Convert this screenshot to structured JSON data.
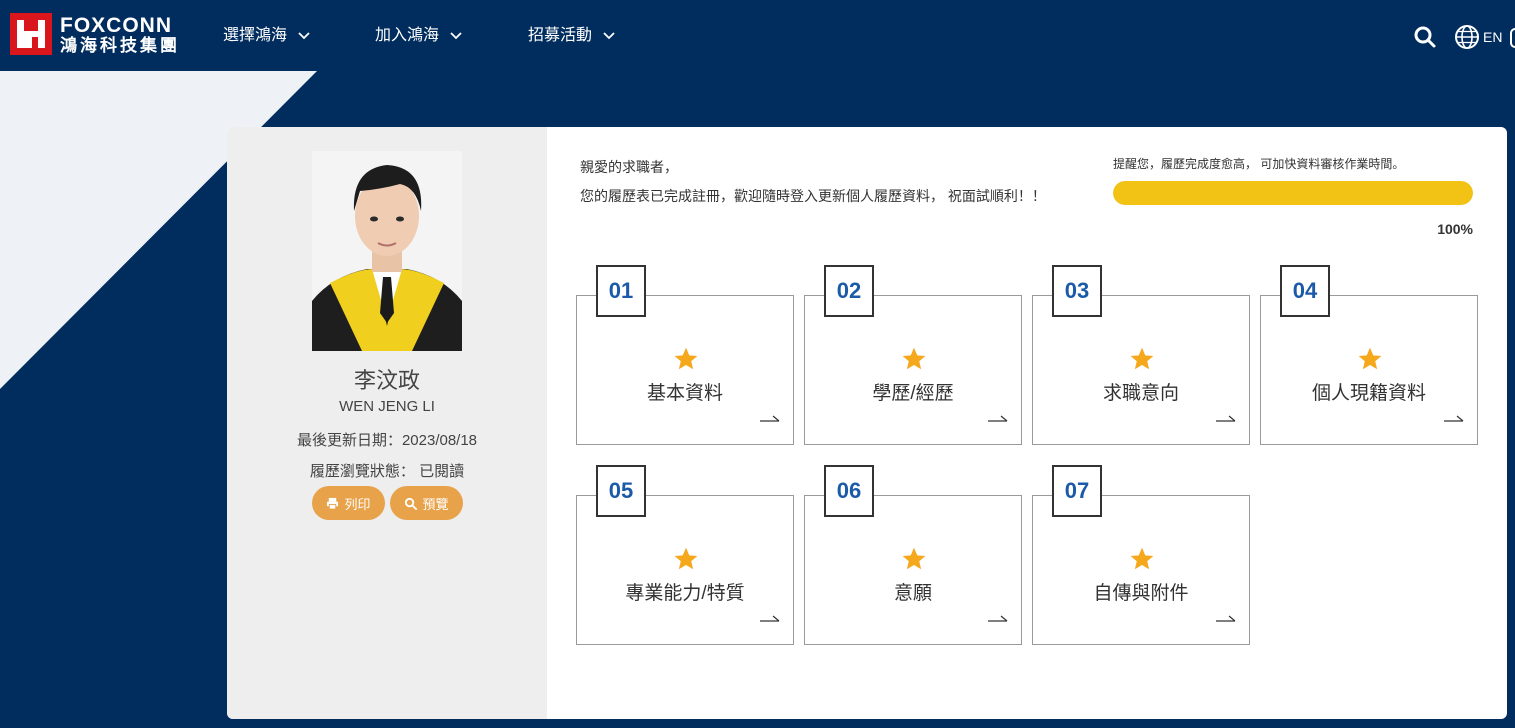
{
  "brand": {
    "name_en": "FOXCONN",
    "name_zh": "鴻海科技集團",
    "colors": {
      "navy": "#002d5e",
      "red": "#d9161c",
      "accent": "#f2c215",
      "button": "#e8a24a",
      "number": "#1a5aa8"
    }
  },
  "nav": {
    "items": [
      {
        "label": "選擇鴻海",
        "icon": "chevron-down-icon"
      },
      {
        "label": "加入鴻海",
        "icon": "chevron-down-icon"
      },
      {
        "label": "招募活動",
        "icon": "chevron-down-icon"
      }
    ],
    "search_icon": "search-icon",
    "lang_icon": "globe-icon",
    "lang_label": "EN"
  },
  "profile": {
    "name": "李汶政",
    "name_en": "WEN JENG LI",
    "last_updated": "最後更新日期：2023/08/18",
    "status": "履歷瀏覽狀態： 已閱讀",
    "print_label": "列印",
    "preview_label": "預覽"
  },
  "greeting": {
    "line1": "親愛的求職者，",
    "line2": "您的履歷表已完成註冊，歡迎隨時登入更新個人履歷資料， 祝面試順利！！"
  },
  "progress": {
    "reminder": "提醒您，履歷完成度愈高， 可加快資料審核作業時間。",
    "percent_value": 100,
    "percent_label": "100%"
  },
  "sections": [
    {
      "num": "01",
      "label": "基本資料"
    },
    {
      "num": "02",
      "label": "學歷/經歷"
    },
    {
      "num": "03",
      "label": "求職意向"
    },
    {
      "num": "04",
      "label": "個人現籍資料"
    },
    {
      "num": "05",
      "label": "專業能力/特質"
    },
    {
      "num": "06",
      "label": "意願"
    },
    {
      "num": "07",
      "label": "自傳與附件"
    }
  ]
}
